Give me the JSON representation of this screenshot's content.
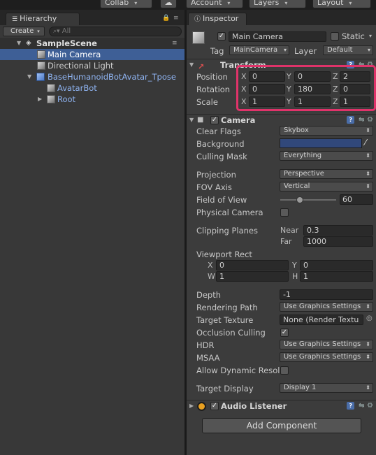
{
  "topbar": {
    "collab_label": "Collab",
    "account_label": "Account",
    "layers_label": "Layers",
    "layout_label": "Layout"
  },
  "hierarchy": {
    "tab_label": "Hierarchy",
    "create_label": "Create",
    "search_placeholder": "All",
    "scene_name": "SampleScene",
    "items": [
      {
        "label": "Main Camera"
      },
      {
        "label": "Directional Light"
      },
      {
        "label": "BaseHumanoidBotAvatar_Tpose"
      },
      {
        "label": "AvatarBot"
      },
      {
        "label": "Root"
      }
    ]
  },
  "inspector": {
    "tab_label": "Inspector",
    "object_name": "Main Camera",
    "static_label": "Static",
    "tag_label": "Tag",
    "tag_value": "MainCamera",
    "layer_label": "Layer",
    "layer_value": "Default",
    "transform": {
      "header": "Transform",
      "position_label": "Position",
      "rotation_label": "Rotation",
      "scale_label": "Scale",
      "axis_x": "X",
      "axis_y": "Y",
      "axis_z": "Z",
      "position": {
        "x": "0",
        "y": "0",
        "z": "2"
      },
      "rotation": {
        "x": "0",
        "y": "180",
        "z": "0"
      },
      "scale": {
        "x": "1",
        "y": "1",
        "z": "1"
      }
    },
    "camera": {
      "header": "Camera",
      "clear_flags_label": "Clear Flags",
      "clear_flags_value": "Skybox",
      "background_label": "Background",
      "background_color": "#31487a",
      "culling_mask_label": "Culling Mask",
      "culling_mask_value": "Everything",
      "projection_label": "Projection",
      "projection_value": "Perspective",
      "fov_axis_label": "FOV Axis",
      "fov_axis_value": "Vertical",
      "field_of_view_label": "Field of View",
      "field_of_view_value": "60",
      "physical_camera_label": "Physical Camera",
      "clipping_planes_label": "Clipping Planes",
      "near_label": "Near",
      "near_value": "0.3",
      "far_label": "Far",
      "far_value": "1000",
      "viewport_rect_label": "Viewport Rect",
      "vp_x_label": "X",
      "vp_x_value": "0",
      "vp_y_label": "Y",
      "vp_y_value": "0",
      "vp_w_label": "W",
      "vp_w_value": "1",
      "vp_h_label": "H",
      "vp_h_value": "1",
      "depth_label": "Depth",
      "depth_value": "-1",
      "rendering_path_label": "Rendering Path",
      "rendering_path_value": "Use Graphics Settings",
      "target_texture_label": "Target Texture",
      "target_texture_value": "None (Render Textu",
      "occlusion_culling_label": "Occlusion Culling",
      "hdr_label": "HDR",
      "hdr_value": "Use Graphics Settings",
      "msaa_label": "MSAA",
      "msaa_value": "Use Graphics Settings",
      "allow_dynamic_label": "Allow Dynamic Resol",
      "target_display_label": "Target Display",
      "target_display_value": "Display 1"
    },
    "audio_listener": {
      "header": "Audio Listener"
    },
    "add_component_label": "Add Component"
  },
  "colors": {
    "selection": "#3e5f96",
    "highlight": "#e0336a",
    "background": "#383838"
  }
}
